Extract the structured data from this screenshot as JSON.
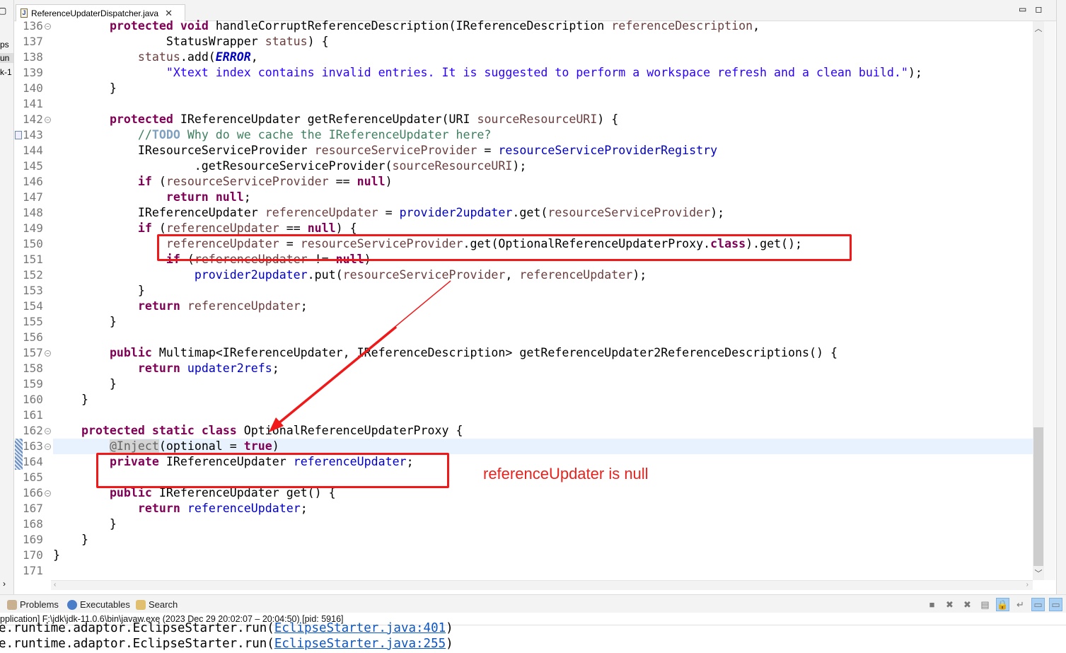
{
  "left_panel": {
    "fragments": [
      "ps",
      "un",
      "k-1"
    ]
  },
  "editor_tab": {
    "title": "ReferenceUpdaterDispatcher.java",
    "icon": "java-file-icon"
  },
  "current_line": 163,
  "lines": [
    {
      "n": 136,
      "fold": true,
      "t": [
        [
          "",
          "        "
        ],
        [
          "kw",
          "protected"
        ],
        [
          "",
          " "
        ],
        [
          "kw",
          "void"
        ],
        [
          "",
          " handleCorruptReferenceDescription(IReferenceDescription "
        ],
        [
          "var",
          "referenceDescription"
        ],
        [
          "",
          ","
        ]
      ]
    },
    {
      "n": 137,
      "t": [
        [
          "",
          "                StatusWrapper "
        ],
        [
          "var",
          "status"
        ],
        [
          "",
          ") {"
        ]
      ]
    },
    {
      "n": 138,
      "t": [
        [
          "",
          "            "
        ],
        [
          "var",
          "status"
        ],
        [
          "",
          ".add("
        ],
        [
          "cst",
          "ERROR"
        ],
        [
          "",
          ","
        ]
      ]
    },
    {
      "n": 139,
      "t": [
        [
          "",
          "                "
        ],
        [
          "str",
          "\"Xtext index contains invalid entries. It is suggested to perform a workspace refresh and a clean build.\""
        ],
        [
          "",
          ");"
        ]
      ]
    },
    {
      "n": 140,
      "t": [
        [
          "",
          "        }"
        ]
      ]
    },
    {
      "n": 141,
      "t": []
    },
    {
      "n": 142,
      "fold": true,
      "t": [
        [
          "",
          "        "
        ],
        [
          "kw",
          "protected"
        ],
        [
          "",
          " IReferenceUpdater getReferenceUpdater(URI "
        ],
        [
          "var",
          "sourceResourceURI"
        ],
        [
          "",
          ") {"
        ]
      ]
    },
    {
      "n": 143,
      "task": true,
      "t": [
        [
          "",
          "            "
        ],
        [
          "cmt",
          "//"
        ],
        [
          "todo",
          "TODO"
        ],
        [
          "cmt",
          " Why do we cache the IReferenceUpdater here?"
        ]
      ]
    },
    {
      "n": 144,
      "t": [
        [
          "",
          "            IResourceServiceProvider "
        ],
        [
          "var",
          "resourceServiceProvider"
        ],
        [
          "",
          " = "
        ],
        [
          "fld",
          "resourceServiceProviderRegistry"
        ]
      ]
    },
    {
      "n": 145,
      "t": [
        [
          "",
          "                    .getResourceServiceProvider("
        ],
        [
          "var",
          "sourceResourceURI"
        ],
        [
          "",
          ");"
        ]
      ]
    },
    {
      "n": 146,
      "t": [
        [
          "",
          "            "
        ],
        [
          "kw",
          "if"
        ],
        [
          "",
          " ("
        ],
        [
          "var",
          "resourceServiceProvider"
        ],
        [
          "",
          " == "
        ],
        [
          "kw",
          "null"
        ],
        [
          "",
          ")"
        ]
      ]
    },
    {
      "n": 147,
      "t": [
        [
          "",
          "                "
        ],
        [
          "kw",
          "return"
        ],
        [
          "",
          " "
        ],
        [
          "kw",
          "null"
        ],
        [
          "",
          ";"
        ]
      ]
    },
    {
      "n": 148,
      "t": [
        [
          "",
          "            IReferenceUpdater "
        ],
        [
          "var",
          "referenceUpdater"
        ],
        [
          "",
          " = "
        ],
        [
          "fld",
          "provider2updater"
        ],
        [
          "",
          ".get("
        ],
        [
          "var",
          "resourceServiceProvider"
        ],
        [
          "",
          ");"
        ]
      ]
    },
    {
      "n": 149,
      "t": [
        [
          "",
          "            "
        ],
        [
          "kw",
          "if"
        ],
        [
          "",
          " ("
        ],
        [
          "var",
          "referenceUpdater"
        ],
        [
          "",
          " == "
        ],
        [
          "kw",
          "null"
        ],
        [
          "",
          ") {"
        ]
      ]
    },
    {
      "n": 150,
      "t": [
        [
          "",
          "                "
        ],
        [
          "var",
          "referenceUpdater"
        ],
        [
          "",
          " = "
        ],
        [
          "var",
          "resourceServiceProvider"
        ],
        [
          "",
          ".get(OptionalReferenceUpdaterProxy."
        ],
        [
          "kw",
          "class"
        ],
        [
          "",
          ").get();"
        ]
      ]
    },
    {
      "n": 151,
      "t": [
        [
          "",
          "                "
        ],
        [
          "kw",
          "if"
        ],
        [
          "",
          " ("
        ],
        [
          "var",
          "referenceUpdater"
        ],
        [
          "",
          " != "
        ],
        [
          "kw",
          "null"
        ],
        [
          "",
          ")"
        ]
      ]
    },
    {
      "n": 152,
      "t": [
        [
          "",
          "                    "
        ],
        [
          "fld",
          "provider2updater"
        ],
        [
          "",
          ".put("
        ],
        [
          "var",
          "resourceServiceProvider"
        ],
        [
          "",
          ", "
        ],
        [
          "var",
          "referenceUpdater"
        ],
        [
          "",
          ");"
        ]
      ]
    },
    {
      "n": 153,
      "t": [
        [
          "",
          "            }"
        ]
      ]
    },
    {
      "n": 154,
      "t": [
        [
          "",
          "            "
        ],
        [
          "kw",
          "return"
        ],
        [
          "",
          " "
        ],
        [
          "var",
          "referenceUpdater"
        ],
        [
          "",
          ";"
        ]
      ]
    },
    {
      "n": 155,
      "t": [
        [
          "",
          "        }"
        ]
      ]
    },
    {
      "n": 156,
      "t": []
    },
    {
      "n": 157,
      "fold": true,
      "t": [
        [
          "",
          "        "
        ],
        [
          "kw",
          "public"
        ],
        [
          "",
          " Multimap<IReferenceUpdater, IReferenceDescription> getReferenceUpdater2ReferenceDescriptions() {"
        ]
      ]
    },
    {
      "n": 158,
      "t": [
        [
          "",
          "            "
        ],
        [
          "kw",
          "return"
        ],
        [
          "",
          " "
        ],
        [
          "fld",
          "updater2refs"
        ],
        [
          "",
          ";"
        ]
      ]
    },
    {
      "n": 159,
      "t": [
        [
          "",
          "        }"
        ]
      ]
    },
    {
      "n": 160,
      "t": [
        [
          "",
          "    }"
        ]
      ]
    },
    {
      "n": 161,
      "t": []
    },
    {
      "n": 162,
      "fold": true,
      "t": [
        [
          "",
          "    "
        ],
        [
          "kw",
          "protected"
        ],
        [
          "",
          " "
        ],
        [
          "kw",
          "static"
        ],
        [
          "",
          " "
        ],
        [
          "kw",
          "class"
        ],
        [
          "",
          " OptionalReferenceUpdaterProxy {"
        ]
      ]
    },
    {
      "n": 163,
      "fold": true,
      "t": [
        [
          "",
          "        "
        ],
        [
          "ann",
          "@Inject"
        ],
        [
          "",
          "(optional = "
        ],
        [
          "kw",
          "true"
        ],
        [
          "",
          ")"
        ]
      ]
    },
    {
      "n": 164,
      "t": [
        [
          "",
          "        "
        ],
        [
          "kw",
          "private"
        ],
        [
          "",
          " IReferenceUpdater "
        ],
        [
          "fld",
          "referenceUpdater"
        ],
        [
          "",
          ";"
        ]
      ]
    },
    {
      "n": 165,
      "t": []
    },
    {
      "n": 166,
      "fold": true,
      "t": [
        [
          "",
          "        "
        ],
        [
          "kw",
          "public"
        ],
        [
          "",
          " IReferenceUpdater get() {"
        ]
      ]
    },
    {
      "n": 167,
      "t": [
        [
          "",
          "            "
        ],
        [
          "kw",
          "return"
        ],
        [
          "",
          " "
        ],
        [
          "fld",
          "referenceUpdater"
        ],
        [
          "",
          ";"
        ]
      ]
    },
    {
      "n": 168,
      "t": [
        [
          "",
          "        }"
        ]
      ]
    },
    {
      "n": 169,
      "t": [
        [
          "",
          "    }"
        ]
      ]
    },
    {
      "n": 170,
      "t": [
        [
          "",
          "}"
        ]
      ]
    },
    {
      "n": 171,
      "t": []
    }
  ],
  "annotation": {
    "text": "referenceUpdater is null",
    "color": "#e8231e"
  },
  "bottom_tabs": [
    {
      "label": "Problems",
      "icon": "problems-icon"
    },
    {
      "label": "Executables",
      "icon": "executables-icon"
    },
    {
      "label": "Search",
      "icon": "search-icon"
    }
  ],
  "console_toolbar": [
    "terminate-icon",
    "remove-launch-icon",
    "remove-all-launches-icon",
    "clear-console-icon",
    "scroll-lock-icon",
    "word-wrap-icon",
    "show-on-stdout-icon",
    "show-on-stderr-icon"
  ],
  "console": {
    "header": "pplication] F:\\jdk\\jdk-11.0.6\\bin\\javaw.exe  (2023 Dec 29 20:02:07 – 20:04:50) [pid: 5916]",
    "lines": [
      {
        "prefix": "e.runtime.adaptor.EclipseStarter.run(",
        "link": "EclipseStarter.java:401",
        "suffix": ")"
      },
      {
        "prefix": "e.runtime.adaptor.EclipseStarter.run(",
        "link": "EclipseStarter.java:255",
        "suffix": ")"
      }
    ]
  }
}
